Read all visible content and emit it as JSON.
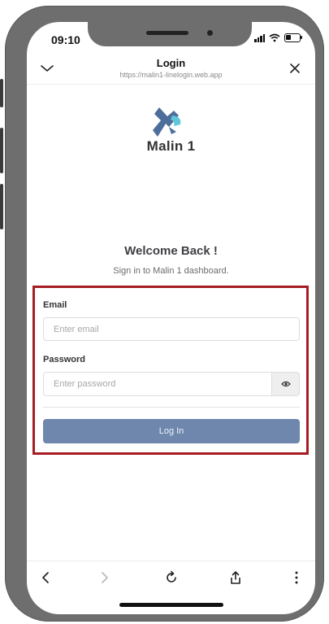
{
  "status": {
    "time": "09:10"
  },
  "header": {
    "title": "Login",
    "url": "https://malin1-linelogin.web.app",
    "collapse_icon": "chevron-down-icon",
    "close_icon": "close-icon"
  },
  "brand": {
    "name": "Malin 1",
    "logo_colors": [
      "#4d6d9a",
      "#5ec6d8"
    ]
  },
  "login": {
    "heading": "Welcome Back !",
    "subheading": "Sign in to Malin 1 dashboard.",
    "email_label": "Email",
    "email_placeholder": "Enter email",
    "password_label": "Password",
    "password_placeholder": "Enter password",
    "toggle_icon": "eye-icon",
    "submit_label": "Log In"
  },
  "toolbar": {
    "icons": [
      "back-icon",
      "forward-icon",
      "reload-icon",
      "share-icon",
      "more-icon"
    ]
  },
  "colors": {
    "accent": "#6f87ad",
    "highlight_border": "#a51d24",
    "frame": "#6e6e6e"
  }
}
